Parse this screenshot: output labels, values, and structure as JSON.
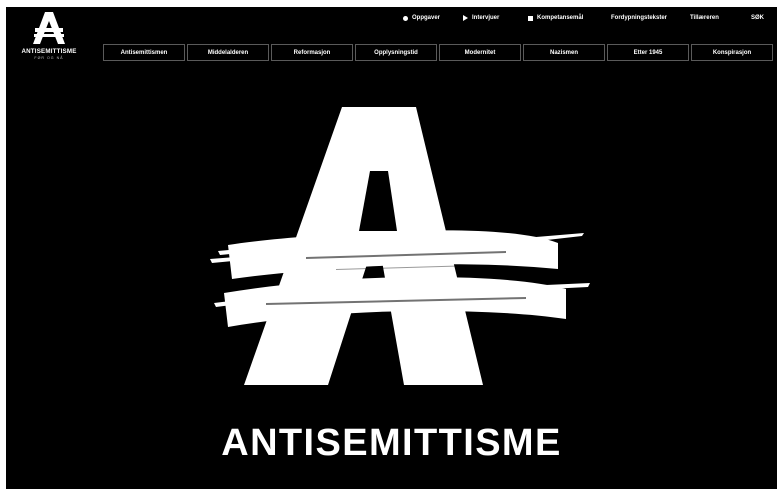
{
  "brand": {
    "wordmark": "ANTISEMITTISME",
    "tagline": "FØR OG NÅ"
  },
  "utility_nav": [
    {
      "label": "Oppgaver",
      "icon": "circle-icon"
    },
    {
      "label": "Intervjuer",
      "icon": "play-icon"
    },
    {
      "label": "Kompetansemål",
      "icon": "square-icon"
    },
    {
      "label": "Fordypningstekster",
      "icon": ""
    },
    {
      "label": "Tillæreren",
      "icon": ""
    },
    {
      "label": "SØK",
      "icon": ""
    }
  ],
  "main_nav": [
    {
      "label": "Antisemittismen"
    },
    {
      "label": "Middelalderen"
    },
    {
      "label": "Reformasjon"
    },
    {
      "label": "Opplysningstid"
    },
    {
      "label": "Modernitet"
    },
    {
      "label": "Nazismen"
    },
    {
      "label": "Etter 1945"
    },
    {
      "label": "Konspirasjon"
    }
  ],
  "hero": {
    "title": "ANTISEMITTISME"
  },
  "colors": {
    "background": "#000000",
    "foreground": "#ffffff",
    "nav_border": "#5a5a5a"
  }
}
